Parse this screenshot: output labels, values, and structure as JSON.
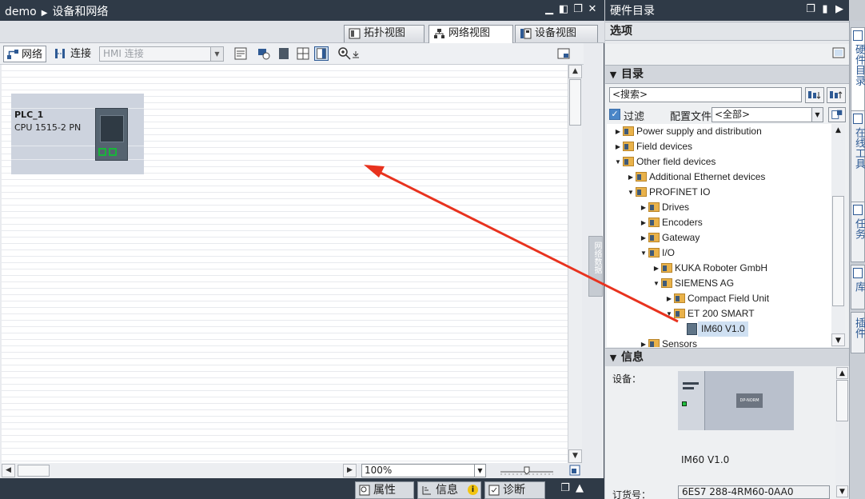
{
  "editor": {
    "breadcrumb_project": "demo",
    "breadcrumb_page": "设备和网络",
    "window_buttons": [
      "▁",
      "◧",
      "❐",
      "✕"
    ]
  },
  "view_tabs": {
    "topology": "拓扑视图",
    "network": "网络视图",
    "device": "设备视图",
    "active": "network"
  },
  "toolbar": {
    "network": "网络",
    "connections": "连接",
    "hmi_connection_placeholder": "HMI 连接"
  },
  "canvas": {
    "device": {
      "name": "PLC_1",
      "type": "CPU 1515-2 PN"
    },
    "side_panel_label": "网络数据"
  },
  "zoom": {
    "value": "100%"
  },
  "bottom_tabs": {
    "properties": "属性",
    "info": "信息",
    "diagnostics": "诊断"
  },
  "hardware_catalog": {
    "title": "硬件目录",
    "options_title": "选项",
    "catalog_title": "目录",
    "search_placeholder": "<搜索>",
    "filter_label": "过滤",
    "profile_label": "配置文件",
    "profile_value": "<全部>",
    "tree": [
      {
        "label": "Power supply and distribution",
        "level": 0,
        "expanded": false,
        "kind": "folder"
      },
      {
        "label": "Field devices",
        "level": 0,
        "expanded": false,
        "kind": "folder"
      },
      {
        "label": "Other field devices",
        "level": 0,
        "expanded": true,
        "kind": "folder"
      },
      {
        "label": "Additional Ethernet devices",
        "level": 1,
        "expanded": false,
        "kind": "folder"
      },
      {
        "label": "PROFINET IO",
        "level": 1,
        "expanded": true,
        "kind": "folder"
      },
      {
        "label": "Drives",
        "level": 2,
        "expanded": false,
        "kind": "folder"
      },
      {
        "label": "Encoders",
        "level": 2,
        "expanded": false,
        "kind": "folder"
      },
      {
        "label": "Gateway",
        "level": 2,
        "expanded": false,
        "kind": "folder"
      },
      {
        "label": "I/O",
        "level": 2,
        "expanded": true,
        "kind": "folder"
      },
      {
        "label": "KUKA Roboter GmbH",
        "level": 3,
        "expanded": false,
        "kind": "folder"
      },
      {
        "label": "SIEMENS AG",
        "level": 3,
        "expanded": true,
        "kind": "folder"
      },
      {
        "label": "Compact Field Unit",
        "level": 4,
        "expanded": false,
        "kind": "folder"
      },
      {
        "label": "ET 200 SMART",
        "level": 4,
        "expanded": true,
        "kind": "folder"
      },
      {
        "label": "IM60 V1.0",
        "level": 5,
        "expanded": null,
        "kind": "module",
        "selected": true
      },
      {
        "label": "Sensors",
        "level": 2,
        "expanded": false,
        "kind": "folder"
      }
    ]
  },
  "info_panel": {
    "title": "信息",
    "device_label": "设备：",
    "preview_tag": "DP-NORM",
    "device_name": "IM60 V1.0",
    "order_label": "订货号：",
    "order_value": "6ES7 288-4RM60-0AA0"
  },
  "side_tabs": [
    "硬件目录",
    "在线工具",
    "任务",
    "库",
    "插件"
  ],
  "colors": {
    "title_bar": "#2f3a47",
    "arrow": "#e8321e",
    "accent": "#4a86c8"
  }
}
